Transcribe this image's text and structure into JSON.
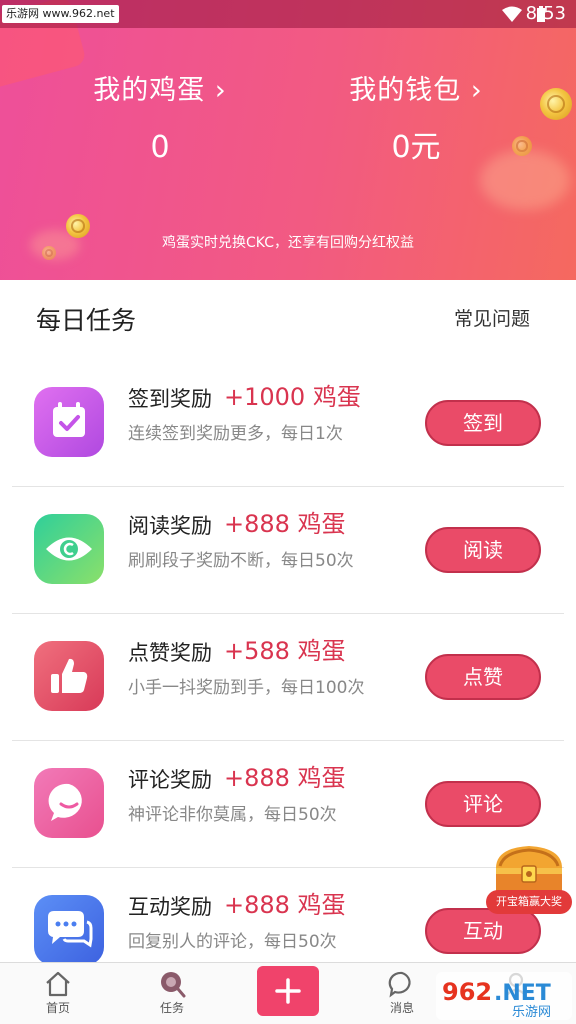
{
  "status_bar": {
    "watermark": "乐游网 www.962.net",
    "time": "8:53"
  },
  "header": {
    "eggs_label": "我的鸡蛋 ›",
    "eggs_value": "0",
    "wallet_label": "我的钱包 ›",
    "wallet_value": "0元",
    "subtitle": "鸡蛋实时兑换CKC，还享有回购分红权益"
  },
  "daily_tasks": {
    "title": "每日任务",
    "faq_label": "常见问题",
    "items": [
      {
        "name": "签到奖励",
        "reward": "+1000 鸡蛋",
        "desc": "连续签到奖励更多，每日1次",
        "button": "签到",
        "icon": "calendar-check-icon",
        "color": "#c454e8"
      },
      {
        "name": "阅读奖励",
        "reward": "+888 鸡蛋",
        "desc": "刷刷段子奖励不断，每日50次",
        "button": "阅读",
        "icon": "eye-icon",
        "color": "#3fcf8e"
      },
      {
        "name": "点赞奖励",
        "reward": "+588 鸡蛋",
        "desc": "小手一抖奖励到手，每日100次",
        "button": "点赞",
        "icon": "thumbs-up-icon",
        "color": "#ea4b63"
      },
      {
        "name": "评论奖励",
        "reward": "+888 鸡蛋",
        "desc": "神评论非你莫属，每日50次",
        "button": "评论",
        "icon": "chat-bubble-icon",
        "color": "#ee5aa2"
      },
      {
        "name": "互动奖励",
        "reward": "+888 鸡蛋",
        "desc": "回复别人的评论，每日50次",
        "button": "互动",
        "icon": "chat-bubbles-icon",
        "color": "#4a7ef0"
      }
    ]
  },
  "treasure": {
    "label": "开宝箱赢大奖"
  },
  "bottom_nav": {
    "items": [
      {
        "label": "首页",
        "icon": "home-icon"
      },
      {
        "label": "任务",
        "icon": "task-icon"
      },
      {
        "label": "",
        "icon": "plus-icon"
      },
      {
        "label": "消息",
        "icon": "message-icon"
      },
      {
        "label": "",
        "icon": "profile-icon"
      }
    ]
  },
  "watermark_br": "962.NET 乐游网"
}
